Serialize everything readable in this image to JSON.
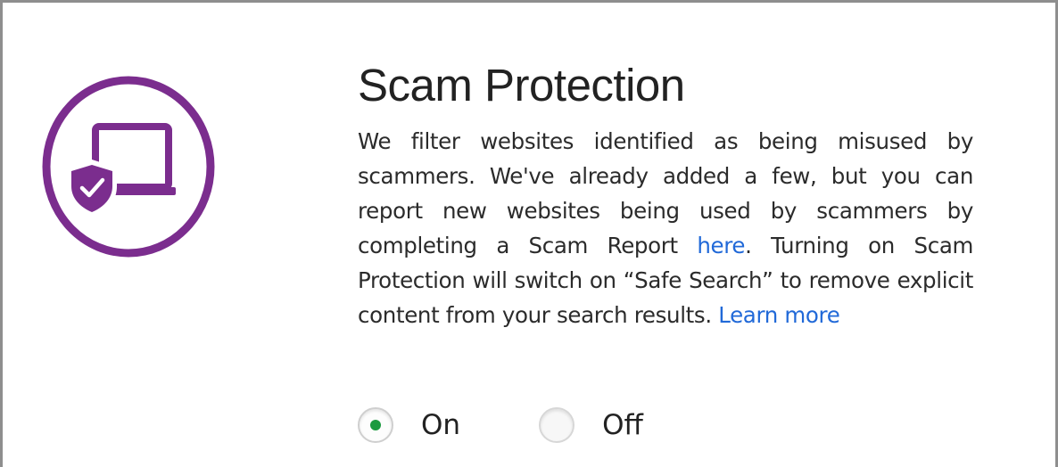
{
  "section": {
    "title": "Scam Protection",
    "description_part1": "We filter websites identified as being misused by scammers. We've already added a few, but you can report new websites being used by scammers by completing a Scam Report ",
    "here_link": "here",
    "description_part2": ". Turning on Scam Protection will switch on “Safe Search” to remove explicit content from your search results. ",
    "learn_more_link": "Learn more"
  },
  "icon": {
    "name": "laptop-shield-icon",
    "color": "#7b2d8e"
  },
  "colors": {
    "link": "#2169d8",
    "radio_selected": "#1c9a3f"
  },
  "radio_group": {
    "selected": "on",
    "options": [
      {
        "id": "on",
        "label": "On"
      },
      {
        "id": "off",
        "label": "Off"
      }
    ]
  }
}
